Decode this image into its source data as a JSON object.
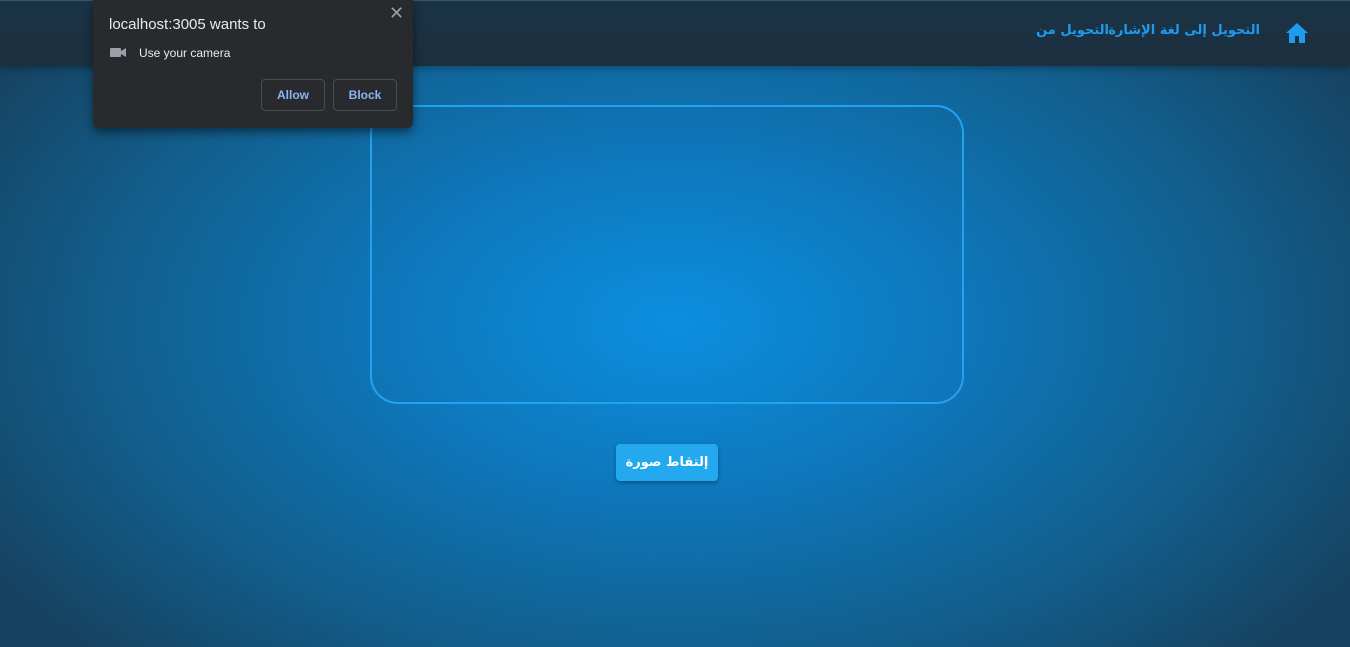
{
  "nav": {
    "home_icon": "home-icon",
    "link_sign_language": "التحويل إلى لغة الإشارة",
    "link_from": "التحويل من"
  },
  "main": {
    "capture_label": "إلتقاط صورة"
  },
  "permission": {
    "title": "localhost:3005 wants to",
    "camera_icon": "video-camera-icon",
    "request_text": "Use your camera",
    "allow_label": "Allow",
    "block_label": "Block",
    "close_icon": "close-icon"
  },
  "colors": {
    "accent": "#1e9bf0",
    "button": "#24a9ef",
    "topbar": "#1c2f3f",
    "popup": "#292a2d",
    "popup_link": "#8ab4f8"
  }
}
